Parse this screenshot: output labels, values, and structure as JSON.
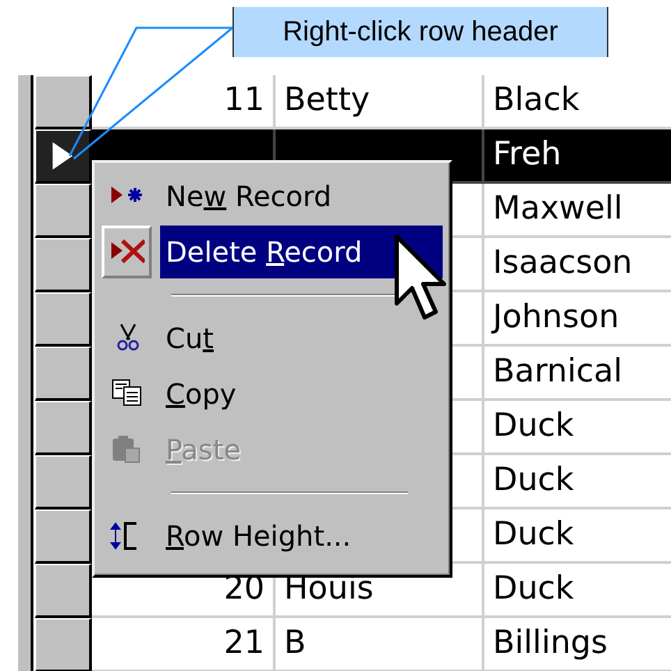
{
  "callout": {
    "text": "Right-click row header"
  },
  "rows": [
    {
      "number": "11",
      "first_name": "Betty",
      "last_name": "Black",
      "selected": false
    },
    {
      "last_name": "Freh",
      "selected": true
    },
    {
      "last_name": "Maxwell",
      "selected": false
    },
    {
      "last_name": "Isaacson",
      "selected": false
    },
    {
      "last_name": "Johnson",
      "selected": false
    },
    {
      "last_name": "Barnical",
      "selected": false
    },
    {
      "last_name": "Duck",
      "selected": false
    },
    {
      "last_name": "Duck",
      "selected": false
    },
    {
      "last_name": "Duck",
      "selected": false
    },
    {
      "number": "20",
      "first_name": "Houis",
      "last_name": "Duck",
      "selected": false
    },
    {
      "number": "21",
      "first_name": "B",
      "last_name": "Billings",
      "selected": false
    }
  ],
  "context_menu": {
    "items": [
      {
        "kind": "item",
        "label": "New Record",
        "selected": false,
        "disabled": false
      },
      {
        "kind": "item",
        "label": "Delete Record",
        "selected": true,
        "disabled": false
      },
      {
        "kind": "separator"
      },
      {
        "kind": "item",
        "label": "Cut",
        "selected": false,
        "disabled": false
      },
      {
        "kind": "item",
        "label": "Copy",
        "selected": false,
        "disabled": false
      },
      {
        "kind": "item",
        "label": "Paste",
        "selected": false,
        "disabled": true
      },
      {
        "kind": "separator"
      },
      {
        "kind": "item",
        "label": "Row Height...",
        "selected": false,
        "disabled": false
      }
    ]
  }
}
